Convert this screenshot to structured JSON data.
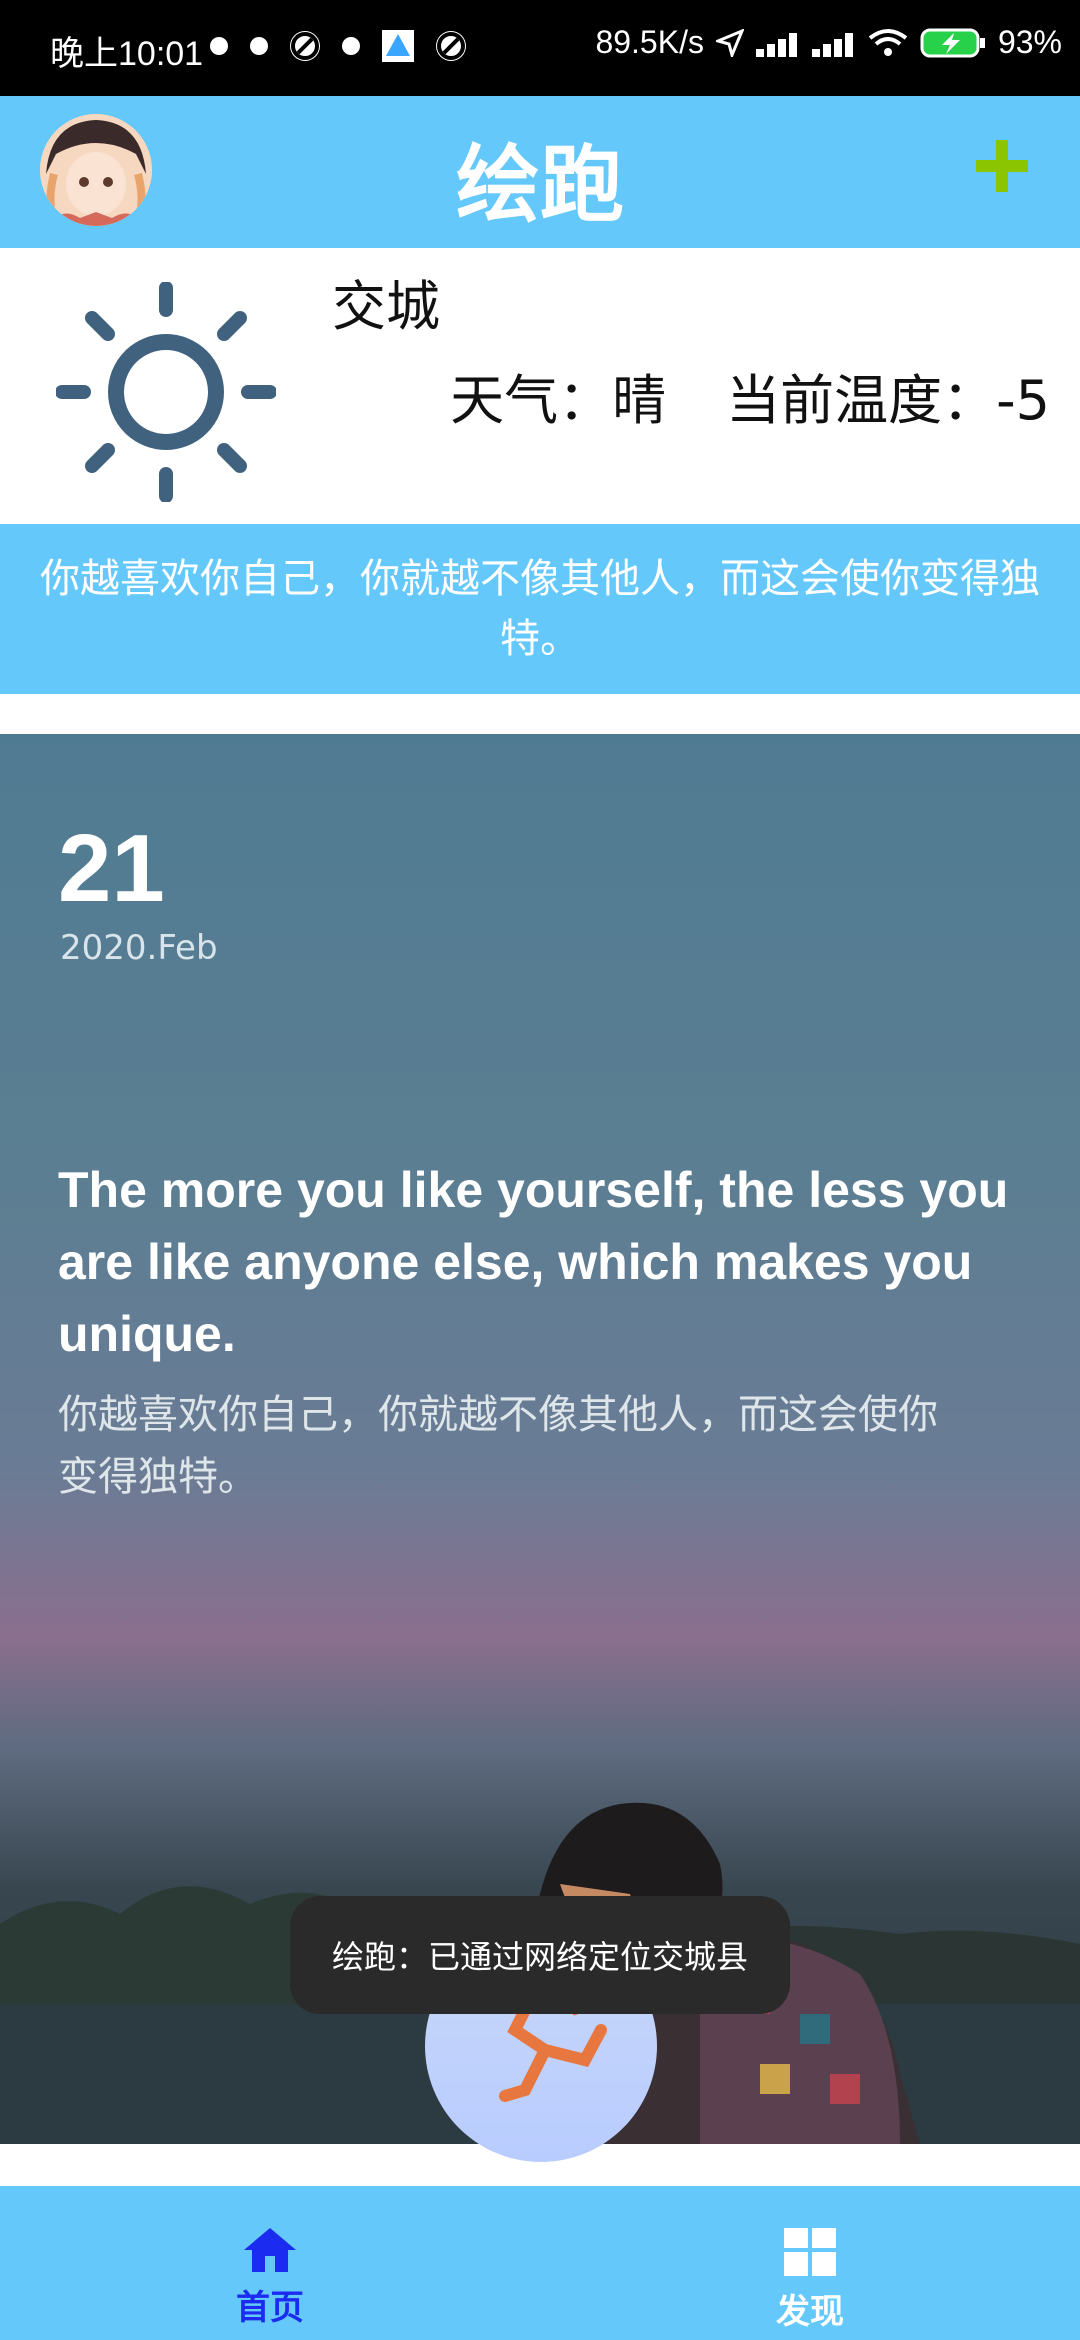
{
  "status_bar": {
    "time": "晚上10:01",
    "network_speed": "89.5K/s",
    "battery": "93%"
  },
  "app_bar": {
    "title": "绘跑",
    "add_icon": "plus-icon",
    "accent_color": "#64c8fb",
    "plus_color": "#8bc400"
  },
  "weather": {
    "city": "交城",
    "condition_label": "天气：晴",
    "temperature_label": "当前温度：-5",
    "icon": "sun-icon"
  },
  "banner": {
    "text": "你越喜欢你自己，你就越不像其他人，而这会使你变得独特。"
  },
  "card": {
    "day": "21",
    "month_year": "2020.Feb",
    "quote_en": "The more you like yourself, the less you are like anyone else, which makes you unique.",
    "quote_cn": "你越喜欢你自己，你就越不像其他人，而这会使你变得独特。"
  },
  "toast": {
    "text": "绘跑：已通过网络定位交城县"
  },
  "bottom_nav": {
    "items": [
      {
        "label": "首页",
        "icon": "home-icon",
        "active": true
      },
      {
        "label": "发现",
        "icon": "grid-icon",
        "active": false
      }
    ],
    "active_color": "#1b2bf0"
  }
}
